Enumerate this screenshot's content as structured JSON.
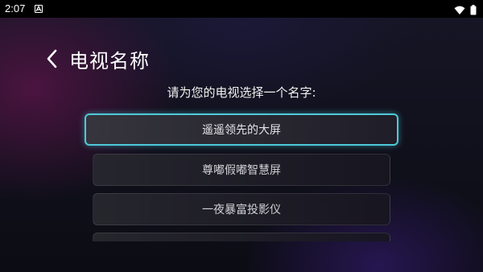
{
  "status_bar": {
    "time": "2:07",
    "icons": [
      "notification-a-icon",
      "wifi-icon",
      "battery-icon"
    ]
  },
  "header": {
    "back_icon": "chevron-left-icon",
    "title": "电视名称"
  },
  "subtitle": "请为您的电视选择一个名字:",
  "options": [
    {
      "label": "遥遥领先的大屏",
      "focused": true
    },
    {
      "label": "尊嘟假嘟智慧屏",
      "focused": false
    },
    {
      "label": "一夜暴富投影仪",
      "focused": false
    },
    {
      "label": "",
      "focused": false
    }
  ],
  "colors": {
    "focus_border": "#4ec9d9",
    "background": "#0c0c14"
  }
}
